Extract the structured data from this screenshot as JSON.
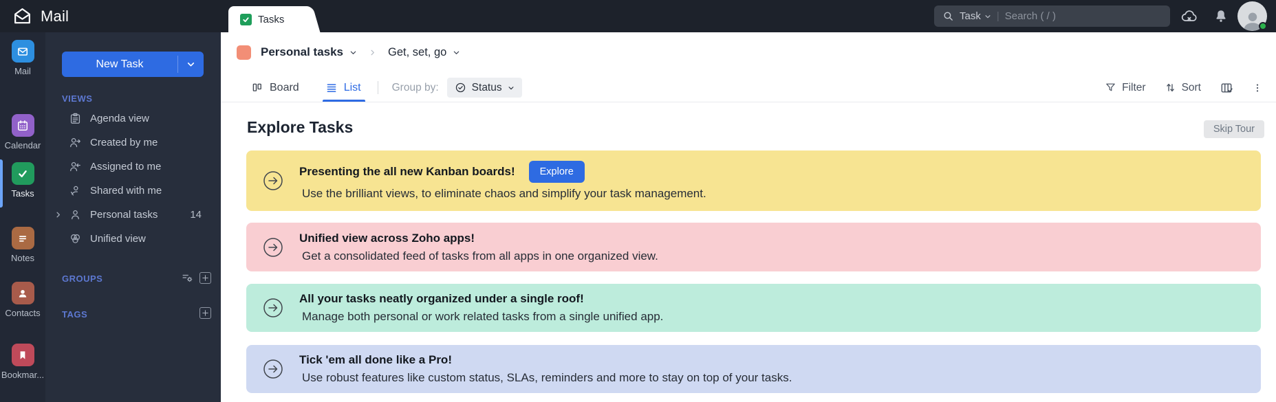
{
  "colors": {
    "accent_blue": "#2e6be2",
    "rail_active_bar": "#6ca4f8",
    "breadcrumb_swatch": "#f28e76"
  },
  "topbar": {
    "app_name": "Mail",
    "tab_label": "Tasks",
    "search_scope": "Task",
    "search_placeholder": "Search ( / )"
  },
  "rail": {
    "items": [
      {
        "label": "Mail",
        "color": "#2d8fe0"
      },
      {
        "label": "Calendar",
        "color": "#9161c9"
      },
      {
        "label": "Tasks",
        "color": "#219b5d"
      },
      {
        "label": "Notes",
        "color": "#aa6a43"
      },
      {
        "label": "Contacts",
        "color": "#a85b4b"
      },
      {
        "label": "Bookmar...",
        "color": "#bf4a5a"
      }
    ]
  },
  "sidebar": {
    "new_task_label": "New Task",
    "views_title": "VIEWS",
    "views": [
      {
        "label": "Agenda view"
      },
      {
        "label": "Created by me"
      },
      {
        "label": "Assigned to me"
      },
      {
        "label": "Shared with me"
      },
      {
        "label": "Personal tasks",
        "count": "14"
      },
      {
        "label": "Unified view"
      }
    ],
    "groups_title": "GROUPS",
    "tags_title": "TAGS"
  },
  "main": {
    "breadcrumb": {
      "folder": "Personal tasks",
      "list_name": "Get, set, go"
    },
    "toolbar": {
      "board_label": "Board",
      "list_label": "List",
      "group_by_label": "Group by:",
      "status_label": "Status",
      "filter_label": "Filter",
      "sort_label": "Sort"
    },
    "heading": "Explore Tasks",
    "skip_tour_label": "Skip Tour",
    "banners": [
      {
        "title": "Presenting the all new Kanban boards!",
        "button_label": "Explore",
        "description": "Use the brilliant views, to eliminate chaos and simplify your task management.",
        "bg": "#f7e492"
      },
      {
        "title": "Unified view across Zoho apps!",
        "description": "Get a consolidated feed of tasks from all apps in one organized view.",
        "bg": "#f9ced2"
      },
      {
        "title": "All your tasks neatly organized under a single roof!",
        "description": "Manage both personal or work related tasks from a single unified app.",
        "bg": "#bdecdc"
      },
      {
        "title": "Tick 'em all done like a Pro!",
        "description": "Use robust features like custom status, SLAs, reminders and more to stay on top of your tasks.",
        "bg": "#cfd9f2"
      }
    ]
  }
}
